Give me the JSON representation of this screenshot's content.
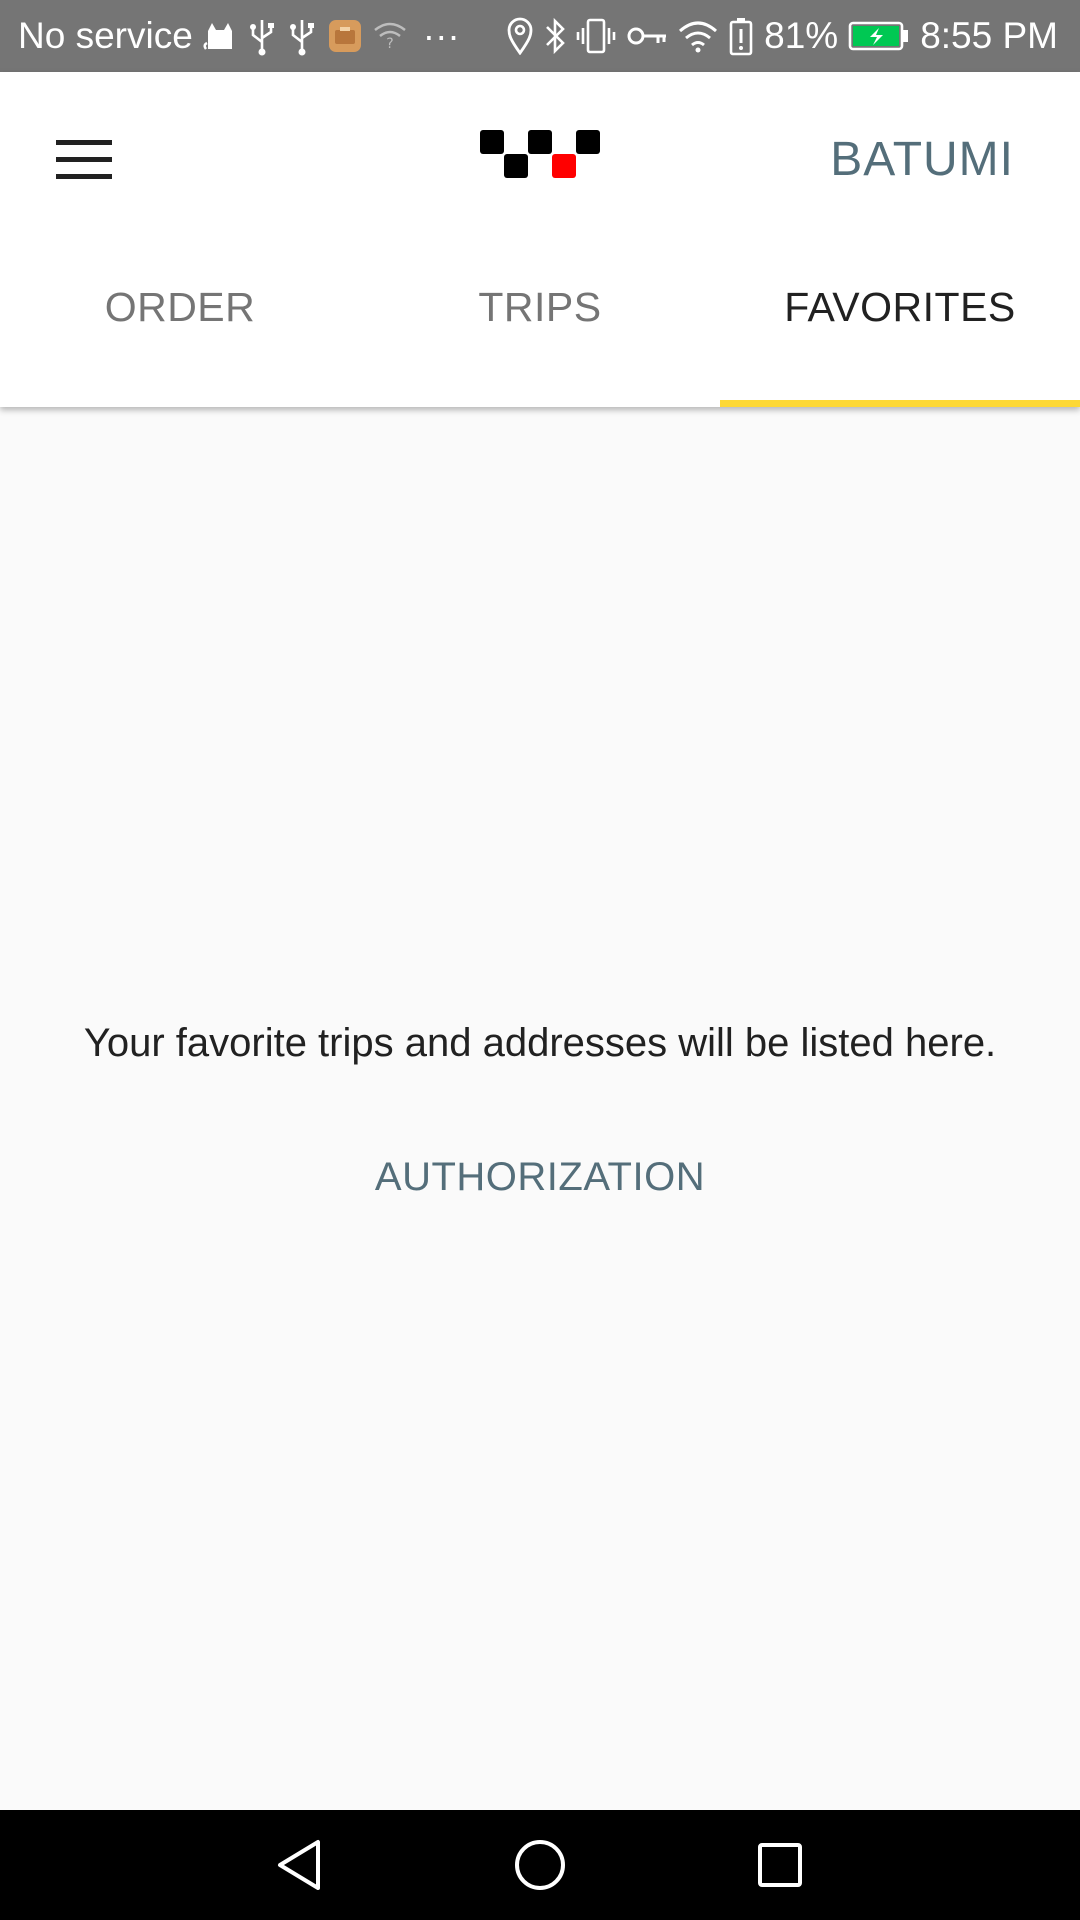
{
  "status_bar": {
    "carrier": "No service",
    "battery_percent": "81%",
    "time": "8:55 PM",
    "overflow": "···",
    "colors": {
      "background": "#757575",
      "battery_fill": "#00c853"
    },
    "left_icons": [
      "cat-icon",
      "usb-icon",
      "usb-icon",
      "app-notification-icon",
      "wifi-question-icon",
      "more-icon"
    ],
    "right_icons": [
      "location-icon",
      "bluetooth-icon",
      "vibrate-icon",
      "vpn-key-icon",
      "wifi-icon",
      "battery-alert-icon",
      "battery-charging-icon"
    ]
  },
  "app_bar": {
    "menu_icon": "hamburger-menu-icon",
    "logo_icon": "checker-logo-icon",
    "city": "BATUMI",
    "colors": {
      "logo_black": "#000000",
      "logo_red": "#ff0000",
      "city_text": "#546e7a"
    }
  },
  "tabs": {
    "items": [
      {
        "label": "ORDER",
        "active": false
      },
      {
        "label": "TRIPS",
        "active": false
      },
      {
        "label": "FAVORITES",
        "active": true
      }
    ],
    "colors": {
      "indicator": "#fdd835",
      "active_text": "#212121",
      "inactive_text": "#757575"
    }
  },
  "favorites": {
    "empty_message": "Your favorite trips and addresses will be listed here.",
    "auth_button": "AUTHORIZATION"
  },
  "nav_bar": {
    "buttons": [
      "back-icon",
      "home-icon",
      "recents-icon"
    ],
    "colors": {
      "background": "#000000",
      "icon": "#ffffff"
    }
  }
}
